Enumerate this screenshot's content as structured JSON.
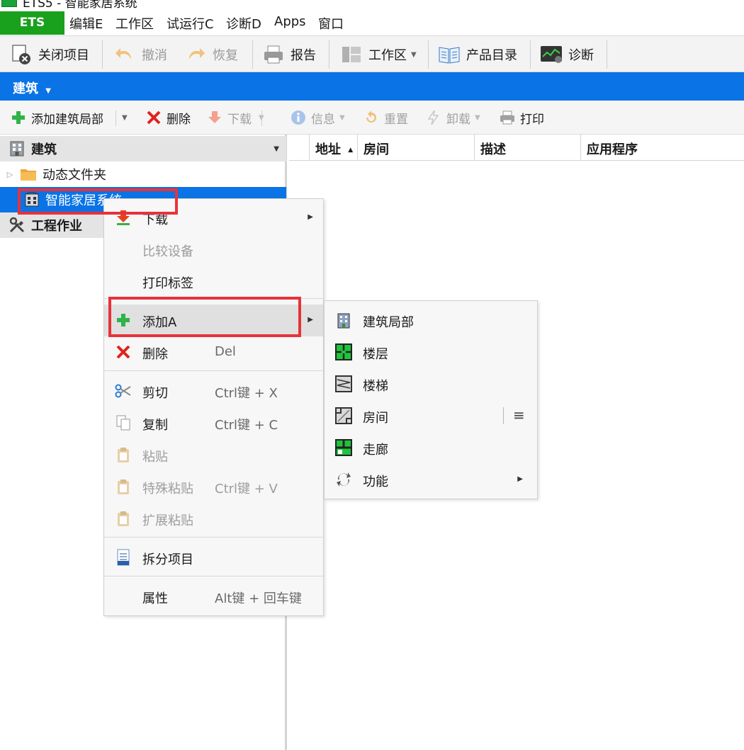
{
  "window": {
    "title": "ETS5 - 智能家居系统"
  },
  "menubar": {
    "ets_tab": "ETS",
    "items": [
      "编辑E",
      "工作区",
      "试运行C",
      "诊断D",
      "Apps",
      "窗口"
    ]
  },
  "main_toolbar": {
    "close_project": "关闭项目",
    "undo": "撤消",
    "redo": "恢复",
    "report": "报告",
    "workspace": "工作区",
    "catalog": "产品目录",
    "diagnostics": "诊断"
  },
  "panel": {
    "title": "建筑"
  },
  "sub_toolbar": {
    "add_building_part": "添加建筑局部",
    "delete": "删除",
    "download": "下载",
    "info": "信息",
    "reset": "重置",
    "unload": "卸载",
    "print": "打印"
  },
  "tree": {
    "header": "建筑",
    "items": [
      "动态文件夹",
      "智能家居系统"
    ],
    "section2": "工程作业"
  },
  "grid": {
    "columns": [
      "地址",
      "房间",
      "描述",
      "应用程序"
    ]
  },
  "context_menu": {
    "items": [
      {
        "label": "下载"
      },
      {
        "label": "比较设备"
      },
      {
        "label": "打印标签"
      },
      {
        "label": "添加A"
      },
      {
        "label": "删除",
        "shortcut": "Del"
      },
      {
        "label": "剪切",
        "shortcut": "Ctrl键 + X"
      },
      {
        "label": "复制",
        "shortcut": "Ctrl键 + C"
      },
      {
        "label": "粘贴"
      },
      {
        "label": "特殊粘贴",
        "shortcut": "Ctrl键 + V"
      },
      {
        "label": "扩展粘贴"
      },
      {
        "label": "拆分项目"
      },
      {
        "label": "属性",
        "shortcut": "Alt键 + 回车键"
      }
    ]
  },
  "submenu": {
    "items": [
      {
        "label": "建筑局部"
      },
      {
        "label": "楼层"
      },
      {
        "label": "楼梯"
      },
      {
        "label": "房间"
      },
      {
        "label": "走廊"
      },
      {
        "label": "功能"
      }
    ]
  },
  "colors": {
    "accent_blue": "#0a73e6",
    "ets_green": "#19a11d",
    "highlight_red": "#e8323a"
  }
}
